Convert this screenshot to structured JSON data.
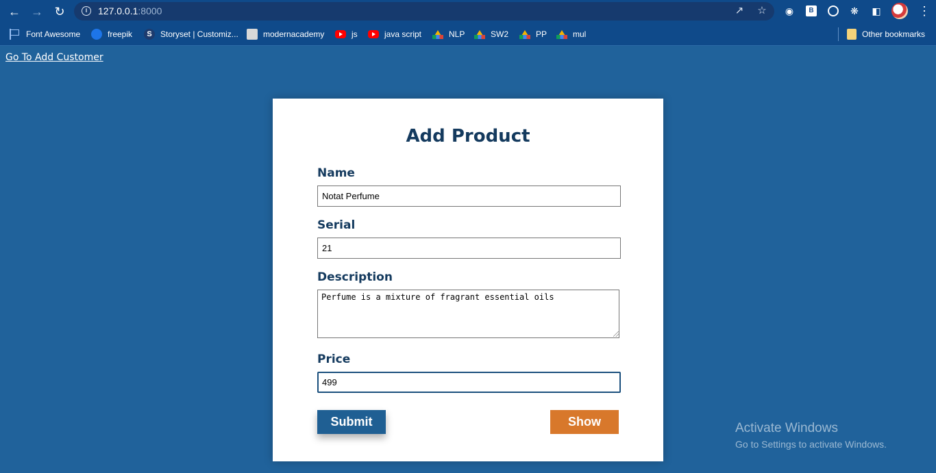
{
  "browser": {
    "url_host": "127.0.0.1",
    "url_port": ":8000",
    "icons": [
      "back-icon",
      "forward-icon",
      "reload-icon",
      "info-icon",
      "share-icon",
      "star-icon",
      "camera-icon",
      "extension-b-icon",
      "extension-circle-icon",
      "puzzle-icon",
      "side-panel-icon",
      "avatar",
      "menu-icon"
    ]
  },
  "bookmarks": {
    "items": [
      {
        "label": "Font Awesome",
        "icon": "flag-icon"
      },
      {
        "label": "freepik",
        "icon": "freepik-icon"
      },
      {
        "label": "Storyset | Customiz...",
        "icon": "storyset-icon"
      },
      {
        "label": "modernacademy",
        "icon": "page-icon"
      },
      {
        "label": "js",
        "icon": "youtube-icon"
      },
      {
        "label": "java script",
        "icon": "youtube-icon"
      },
      {
        "label": "NLP",
        "icon": "drive-icon"
      },
      {
        "label": "SW2",
        "icon": "drive-icon"
      },
      {
        "label": "PP",
        "icon": "drive-icon"
      },
      {
        "label": "mul",
        "icon": "drive-icon"
      }
    ],
    "other": "Other bookmarks"
  },
  "page": {
    "top_link": "Go To Add Customer"
  },
  "form": {
    "title": "Add Product",
    "name_label": "Name",
    "name_value": "Notat Perfume",
    "serial_label": "Serial",
    "serial_value": "21",
    "description_label": "Description",
    "description_value": "Perfume is a mixture of fragrant essential oils",
    "price_label": "Price",
    "price_value": "499",
    "submit_label": "Submit",
    "show_label": "Show"
  },
  "watermark": {
    "title": "Activate Windows",
    "subtitle": "Go to Settings to activate Windows."
  },
  "colors": {
    "page_background": "#20629b",
    "browser_chrome": "#0f4a8a",
    "form_heading": "#143a5e",
    "submit_button": "#1f5f93",
    "show_button": "#d8782b"
  }
}
